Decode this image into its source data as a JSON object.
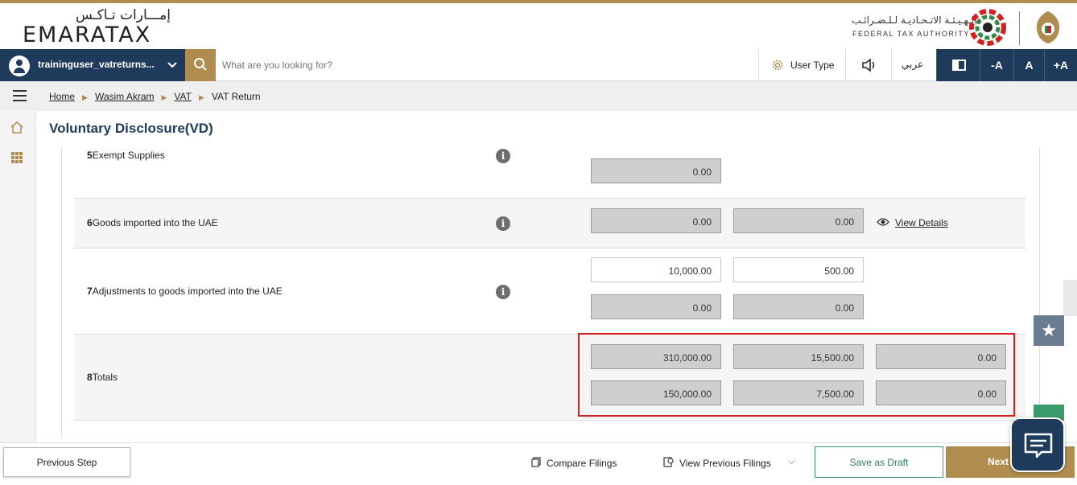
{
  "brand": {
    "logo_ar": "إمـــارات تـاكـس",
    "logo_en": "EMARATAX",
    "authority_ar": "الـهـيـئـة الاتـحـاديـة لـلـضـرائـب",
    "authority_en": "FEDERAL TAX AUTHORITY"
  },
  "nav": {
    "username": "traininguser_vatreturns...",
    "search_placeholder": "What are you looking for?",
    "user_type": "User Type",
    "language": "عربي",
    "font_decrease": "-A",
    "font_normal": "A",
    "font_increase": "+A"
  },
  "breadcrumb": [
    {
      "label": "Home"
    },
    {
      "label": "Wasim Akram"
    },
    {
      "label": "VAT"
    },
    {
      "label": "VAT Return"
    }
  ],
  "page_title": "Voluntary Disclosure(VD)",
  "rows": [
    {
      "number": "5",
      "label": "Exempt Supplies",
      "values": [
        "0.00"
      ]
    },
    {
      "number": "6",
      "label": "Goods imported into the UAE",
      "values": [
        "0.00",
        "0.00"
      ],
      "link": "View Details"
    },
    {
      "number": "7",
      "label": "Adjustments to goods imported into the UAE",
      "input_values": [
        "10,000.00",
        "500.00"
      ],
      "values": [
        "0.00",
        "0.00"
      ]
    },
    {
      "number": "8",
      "label": "Totals",
      "line1": [
        "310,000.00",
        "15,500.00",
        "0.00"
      ],
      "line2": [
        "150,000.00",
        "7,500.00",
        "0.00"
      ]
    }
  ],
  "info_glyph": "i",
  "footer": {
    "previous": "Previous Step",
    "compare": "Compare Filings",
    "view_previous": "View Previous Filings",
    "save_draft": "Save as Draft",
    "next": "Next"
  },
  "colors": {
    "brand_navy": "#1f3b5c",
    "brand_gold": "#b08c4e",
    "highlight_red": "#d21f1f",
    "draft_green": "#3a9b6b"
  },
  "icons": [
    "user-avatar-icon",
    "search-icon",
    "gear-icon",
    "speaker-icon",
    "contrast-icon",
    "hamburger-menu-icon",
    "home-icon",
    "apps-grid-icon",
    "info-icon",
    "eye-icon",
    "star-icon",
    "chat-icon",
    "compare-icon",
    "history-icon",
    "chevron-down-icon"
  ]
}
